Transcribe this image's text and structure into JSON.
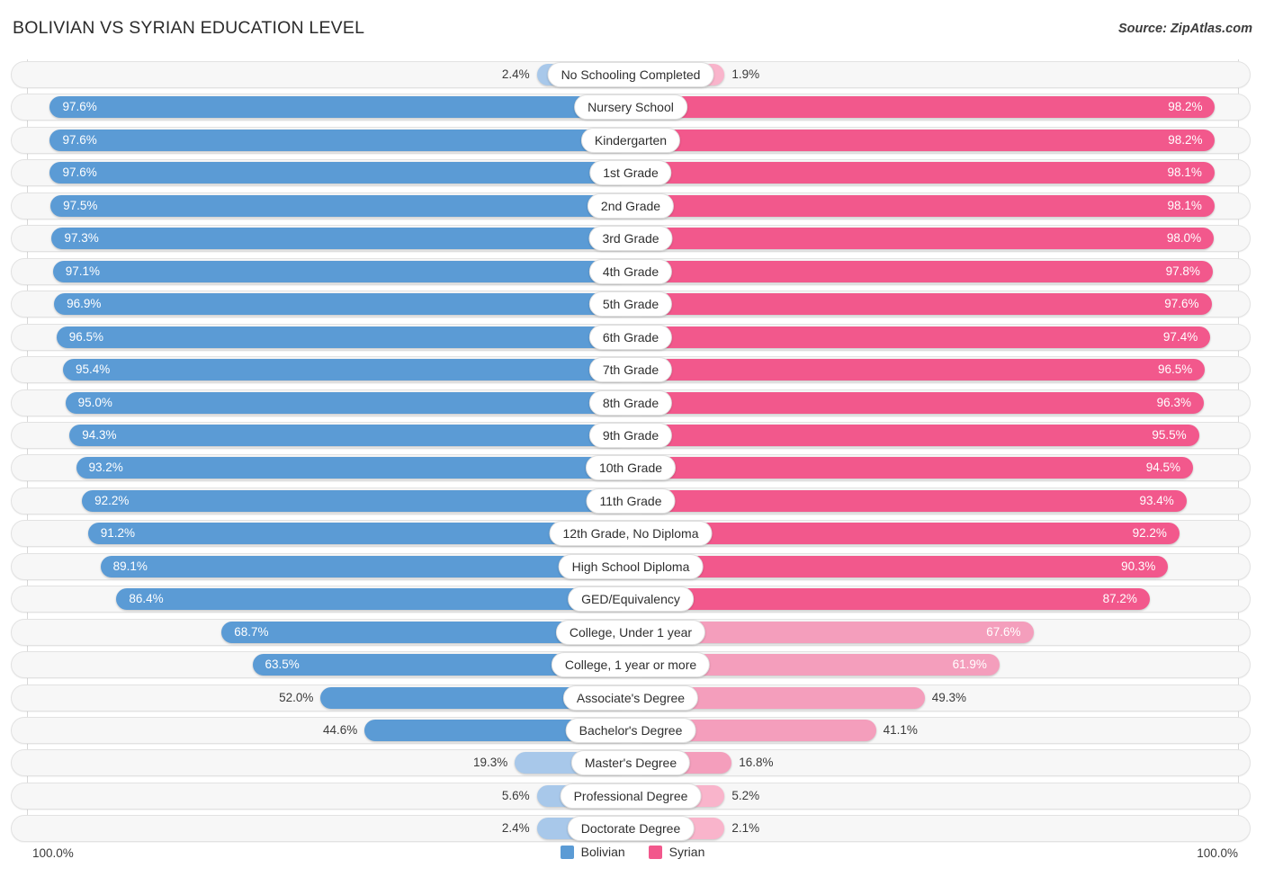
{
  "header": {
    "title": "BOLIVIAN VS SYRIAN EDUCATION LEVEL",
    "source": "Source: ZipAtlas.com"
  },
  "axis": {
    "left_label": "100.0%",
    "right_label": "100.0%"
  },
  "legend": {
    "items": [
      {
        "label": "Bolivian",
        "color": "#5b9bd5"
      },
      {
        "label": "Syrian",
        "color": "#f2588c"
      }
    ]
  },
  "colors": {
    "blue_strong": "#5b9bd5",
    "blue_light": "#a8c8ea",
    "pink_strong": "#f2588c",
    "pink_light": "#f49ebc",
    "pink_pale": "#f9b4cb",
    "track": "#f7f7f7",
    "track_border": "#e2e2e2"
  },
  "chart_data": {
    "type": "bar",
    "title": "BOLIVIAN VS SYRIAN EDUCATION LEVEL",
    "subtitle": "",
    "xlabel": "",
    "ylabel": "",
    "orientation": "horizontal-diverging",
    "xlim": [
      0,
      100
    ],
    "grid": false,
    "legend_position": "bottom-center",
    "categories": [
      "No Schooling Completed",
      "Nursery School",
      "Kindergarten",
      "1st Grade",
      "2nd Grade",
      "3rd Grade",
      "4th Grade",
      "5th Grade",
      "6th Grade",
      "7th Grade",
      "8th Grade",
      "9th Grade",
      "10th Grade",
      "11th Grade",
      "12th Grade, No Diploma",
      "High School Diploma",
      "GED/Equivalency",
      "College, Under 1 year",
      "College, 1 year or more",
      "Associate's Degree",
      "Bachelor's Degree",
      "Master's Degree",
      "Professional Degree",
      "Doctorate Degree"
    ],
    "series": [
      {
        "name": "Bolivian",
        "color": "#5b9bd5",
        "values": [
          2.4,
          97.6,
          97.6,
          97.6,
          97.5,
          97.3,
          97.1,
          96.9,
          96.5,
          95.4,
          95.0,
          94.3,
          93.2,
          92.2,
          91.2,
          89.1,
          86.4,
          68.7,
          63.5,
          52.0,
          44.6,
          19.3,
          5.6,
          2.4
        ],
        "labels": [
          "2.4%",
          "97.6%",
          "97.6%",
          "97.6%",
          "97.5%",
          "97.3%",
          "97.1%",
          "96.9%",
          "96.5%",
          "95.4%",
          "95.0%",
          "94.3%",
          "93.2%",
          "92.2%",
          "91.2%",
          "89.1%",
          "86.4%",
          "68.7%",
          "63.5%",
          "52.0%",
          "44.6%",
          "19.3%",
          "5.6%",
          "2.4%"
        ]
      },
      {
        "name": "Syrian",
        "color": "#f2588c",
        "values": [
          1.9,
          98.2,
          98.2,
          98.1,
          98.1,
          98.0,
          97.8,
          97.6,
          97.4,
          96.5,
          96.3,
          95.5,
          94.5,
          93.4,
          92.2,
          90.3,
          87.2,
          67.6,
          61.9,
          49.3,
          41.1,
          16.8,
          5.2,
          2.1
        ],
        "labels": [
          "1.9%",
          "98.2%",
          "98.2%",
          "98.1%",
          "98.1%",
          "98.0%",
          "97.8%",
          "97.6%",
          "97.4%",
          "96.5%",
          "96.3%",
          "95.5%",
          "94.5%",
          "93.4%",
          "92.2%",
          "90.3%",
          "87.2%",
          "67.6%",
          "61.9%",
          "49.3%",
          "41.1%",
          "16.8%",
          "5.2%",
          "2.1%"
        ]
      }
    ]
  }
}
